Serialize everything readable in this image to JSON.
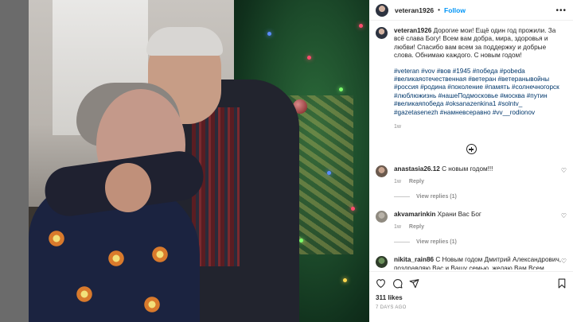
{
  "window": {
    "close_glyph": "×"
  },
  "header": {
    "username": "veteran1926",
    "separator": "•",
    "follow_label": "Follow",
    "more_glyph": "•••"
  },
  "caption": {
    "username": "veteran1926",
    "text": "Дорогие мои! Ещё один год прожили. За всё слава Богу! Всем вам добра, мира, здоровья и любви! Спасибо вам всем за поддержку и добрые слова. Обнимаю каждого. С новым годом!",
    "hashtags": "#veteran #vov #вов #1945 #победа #pobeda #великаяотечественная #ветеран #ветеранывойны #россия #родина #поколение #память #солнечногорск #люблюжизнь #нашеПодмосковье #москва #путин #великаяпобеда #oksanazenkina1 #solntv_ #gazetasenezh #намневсеравно #vv__rodionov",
    "time_ago": "1w"
  },
  "comments": [
    {
      "username": "anastasia26.12",
      "text": "С новым годом!!!",
      "time_ago": "1w",
      "reply_label": "Reply",
      "view_replies": "View replies (1)"
    },
    {
      "username": "akvamarinkin",
      "text": "Храни Вас Бог",
      "time_ago": "1w",
      "reply_label": "Reply",
      "view_replies": "View replies (1)"
    },
    {
      "username": "nikita_rain86",
      "text": "С Новым годом Дмитрий Александрович, поздравляю Вас и Вашу семью, желаю Вам Всем крепкого здоровья, счастья, успехов и Всех мирских благ, пусть сбываются все ваши заветные мечты!"
    }
  ],
  "footer": {
    "likes": "311 likes",
    "date": "7 DAYS AGO"
  },
  "icons": {
    "like": "heart-icon",
    "comment": "comment-icon",
    "share": "paper-plane-icon",
    "save": "bookmark-icon",
    "add_comment": "plus-circle-icon"
  },
  "colors": {
    "link_blue": "#0095f6",
    "hashtag_blue": "#00376b",
    "muted_gray": "#8e8e8e",
    "backdrop": "#6b6b6b"
  }
}
